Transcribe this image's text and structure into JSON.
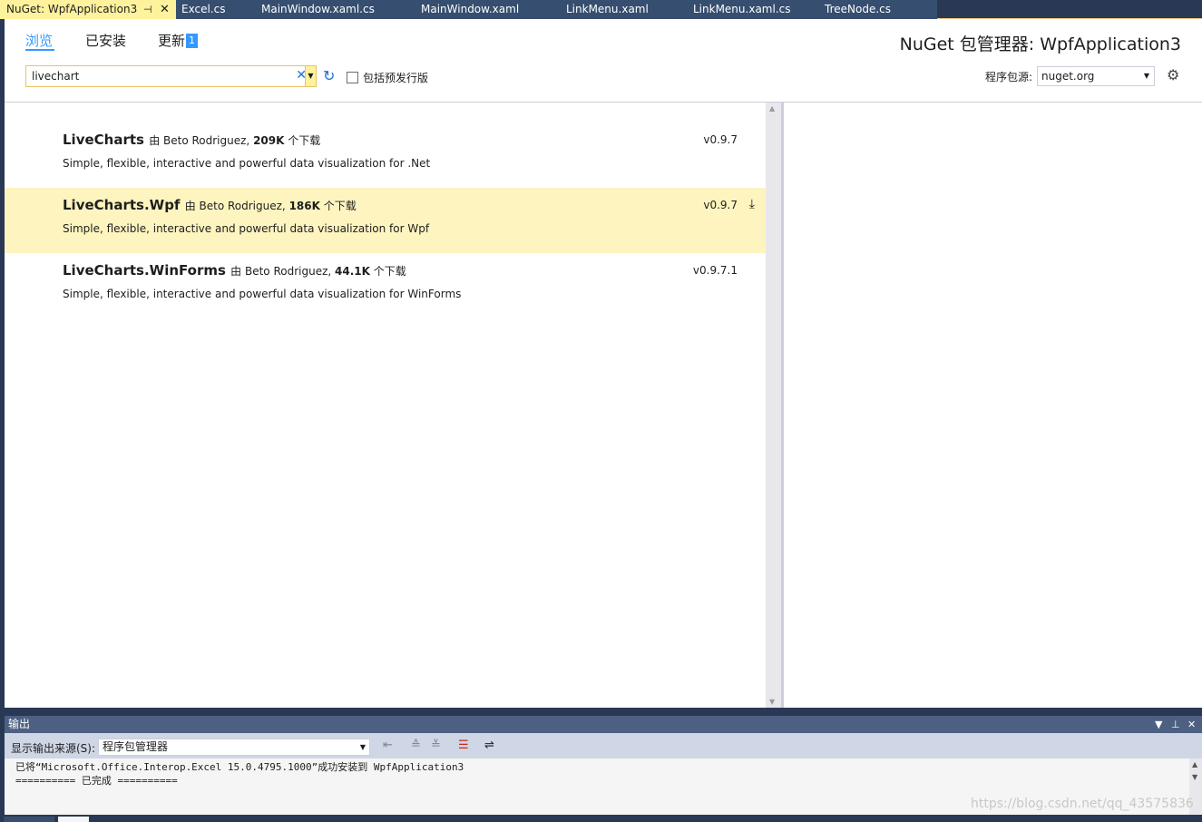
{
  "editor_tabs": [
    {
      "label": "NuGet: WpfApplication3",
      "pin_icon": "⊣",
      "close_icon": "✕"
    },
    {
      "label": "Excel.cs"
    },
    {
      "label": "MainWindow.xaml.cs"
    },
    {
      "label": "MainWindow.xaml"
    },
    {
      "label": "LinkMenu.xaml"
    },
    {
      "label": "LinkMenu.xaml.cs"
    },
    {
      "label": "TreeNode.cs"
    }
  ],
  "nuget": {
    "tabs": {
      "browse": "浏览",
      "installed": "已安装",
      "updates": "更新",
      "updates_badge": "1"
    },
    "title": "NuGet 包管理器: WpfApplication3",
    "search": {
      "value": "livechart"
    },
    "prerelease_label": "包括预发行版",
    "source_label": "程序包源:",
    "source_value": "nuget.org"
  },
  "packages": [
    {
      "name": "LiveCharts",
      "by": "由 Beto Rodriguez,",
      "downloads": "209K",
      "downloads_suffix": "个下载",
      "description": "Simple, flexible, interactive and powerful data visualization for .Net",
      "version": "v0.9.7"
    },
    {
      "name": "LiveCharts.Wpf",
      "by": "由 Beto Rodriguez,",
      "downloads": "186K",
      "downloads_suffix": "个下载",
      "description": "Simple, flexible, interactive and powerful data visualization for Wpf",
      "version": "v0.9.7"
    },
    {
      "name": "LiveCharts.WinForms",
      "by": "由 Beto Rodriguez,",
      "downloads": "44.1K",
      "downloads_suffix": "个下载",
      "description": "Simple, flexible, interactive and powerful data visualization for WinForms",
      "version": "v0.9.7.1"
    }
  ],
  "output": {
    "title": "输出",
    "source_label": "显示输出来源(S):",
    "source_value": "程序包管理器",
    "lines": [
      "已将“Microsoft.Office.Interop.Excel 15.0.4795.1000”成功安装到 WpfApplication3",
      "========== 已完成 =========="
    ]
  },
  "watermark": "https://blog.csdn.net/qq_43575836",
  "colors": {
    "accent": "#3399ff",
    "active_tab": "#fff29d",
    "highlight_row": "#fdf4bf",
    "chrome": "#293955"
  }
}
